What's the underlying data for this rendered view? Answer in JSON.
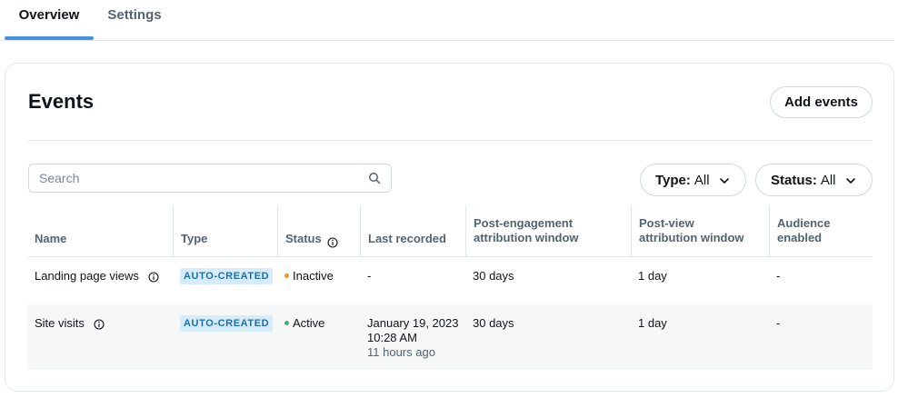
{
  "tabs": [
    {
      "label": "Overview",
      "active": true
    },
    {
      "label": "Settings",
      "active": false
    }
  ],
  "card": {
    "title": "Events",
    "add_button": "Add events"
  },
  "search": {
    "placeholder": "Search",
    "value": ""
  },
  "filters": {
    "type": {
      "label": "Type:",
      "value": "All"
    },
    "status": {
      "label": "Status:",
      "value": "All"
    }
  },
  "table": {
    "columns": {
      "name": "Name",
      "type": "Type",
      "status": "Status",
      "last_recorded": "Last recorded",
      "post_engagement_1": "Post-engagement",
      "post_engagement_2": "attribution window",
      "post_view_1": "Post-view",
      "post_view_2": "attribution window",
      "audience_1": "Audience",
      "audience_2": "enabled"
    },
    "rows": [
      {
        "name": "Landing page views",
        "type": "AUTO-CREATED",
        "status": "Inactive",
        "status_color": "#f0922a",
        "last_recorded": "-",
        "last_recorded_time": "",
        "last_recorded_ago": "",
        "post_engagement": "30 days",
        "post_view": "1 day",
        "audience": "-"
      },
      {
        "name": "Site visits",
        "type": "AUTO-CREATED",
        "status": "Active",
        "status_color": "#4caf7a",
        "last_recorded": "January 19, 2023",
        "last_recorded_time": "10:28 AM",
        "last_recorded_ago": "11 hours ago",
        "post_engagement": "30 days",
        "post_view": "1 day",
        "audience": "-"
      }
    ]
  },
  "colors": {
    "accent": "#4a90e2",
    "badge_bg": "#d6ecfb",
    "badge_text": "#1d6fa6"
  }
}
